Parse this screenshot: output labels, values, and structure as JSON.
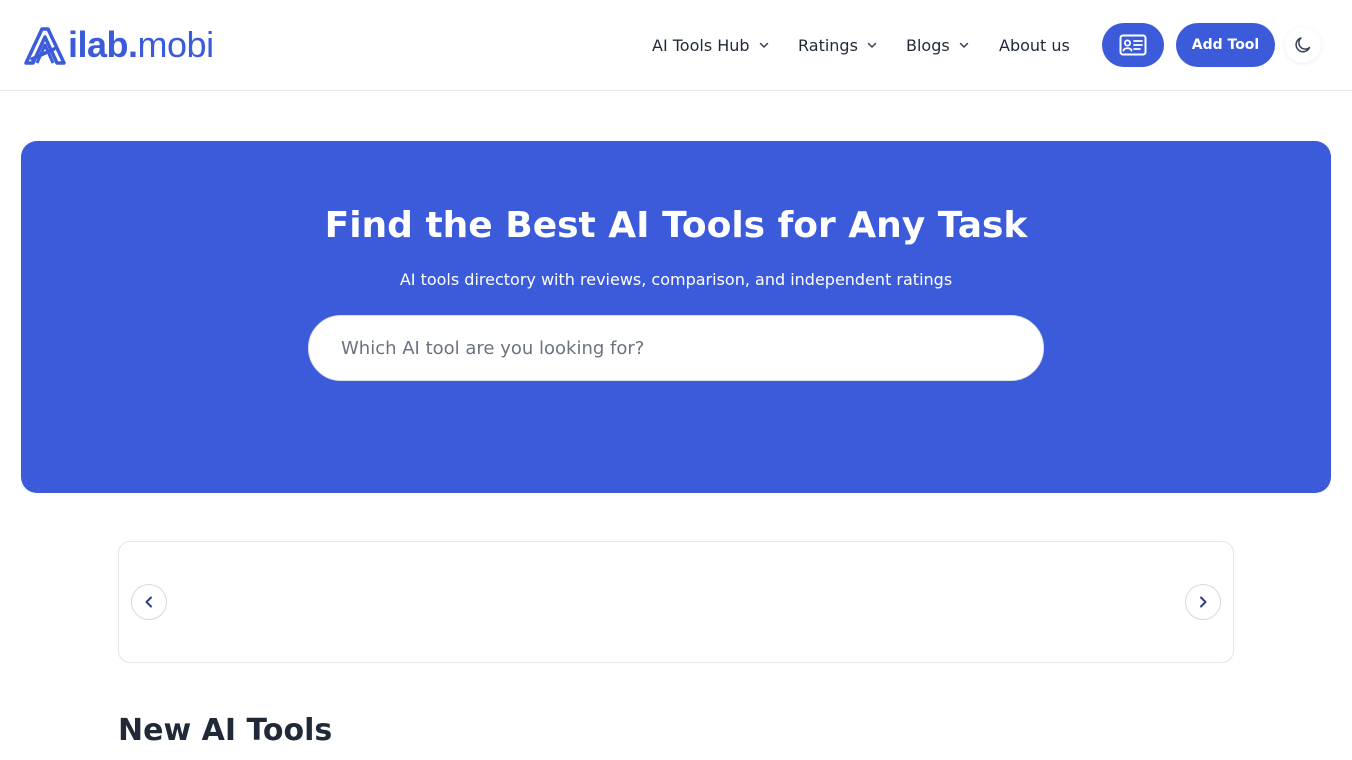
{
  "header": {
    "logo": {
      "text_main": "ilab",
      "text_dot": ".",
      "text_tld": "mobi",
      "icon": "logo-mark-icon"
    },
    "nav": [
      {
        "label": "AI Tools Hub",
        "has_dropdown": true
      },
      {
        "label": "Ratings",
        "has_dropdown": true
      },
      {
        "label": "Blogs",
        "has_dropdown": true
      },
      {
        "label": "About us",
        "has_dropdown": false
      }
    ],
    "id_card_button_icon": "id-card-icon",
    "add_tool_label": "Add Tool",
    "theme_toggle_icon": "moon-icon"
  },
  "hero": {
    "title": "Find the Best AI Tools for Any Task",
    "subtitle": "AI tools directory with reviews, comparison, and independent ratings",
    "search": {
      "placeholder": "Which AI tool are you looking for?",
      "value": ""
    }
  },
  "carousel": {
    "prev_icon": "chevron-left-icon",
    "next_icon": "chevron-right-icon"
  },
  "sections": {
    "new_tools_title": "New AI Tools"
  },
  "colors": {
    "brand": "#3b5bdb",
    "text": "#1f2937",
    "border": "#e5e7eb"
  }
}
